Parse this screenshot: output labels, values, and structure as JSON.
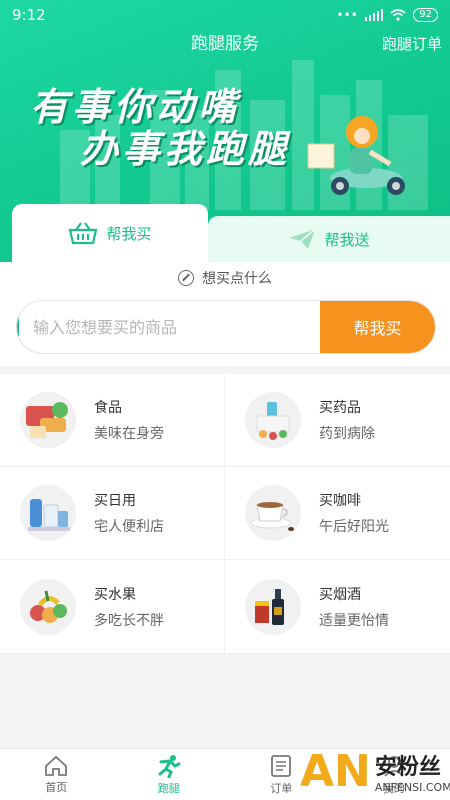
{
  "status": {
    "time": "9:12",
    "dots": "•••",
    "battery": "92"
  },
  "nav": {
    "title": "跑腿服务",
    "right": "跑腿订单"
  },
  "banner": {
    "line1": "有事你动嘴",
    "line2": "办事我跑腿"
  },
  "tabs": [
    {
      "label": "帮我买",
      "icon": "basket-icon",
      "active": true
    },
    {
      "label": "帮我送",
      "icon": "paper-plane-icon",
      "active": false
    }
  ],
  "hint": "想买点什么",
  "search": {
    "placeholder": "输入您想要买的商品",
    "button": "帮我买"
  },
  "categories": [
    {
      "title": "食品",
      "sub": "美味在身旁",
      "icon": "food-icon"
    },
    {
      "title": "买药品",
      "sub": "药到病除",
      "icon": "medicine-icon"
    },
    {
      "title": "买日用",
      "sub": "宅人便利店",
      "icon": "daily-goods-icon"
    },
    {
      "title": "买咖啡",
      "sub": "午后好阳光",
      "icon": "coffee-icon"
    },
    {
      "title": "买水果",
      "sub": "多吃长不胖",
      "icon": "fruit-icon"
    },
    {
      "title": "买烟酒",
      "sub": "适量更怡情",
      "icon": "tobacco-wine-icon"
    }
  ],
  "bottom_nav": [
    {
      "label": "首页",
      "icon": "home-icon",
      "active": false
    },
    {
      "label": "跑腿",
      "icon": "runner-icon",
      "active": true
    },
    {
      "label": "订单",
      "icon": "order-list-icon",
      "active": false
    },
    {
      "label": "我的",
      "icon": "user-icon",
      "active": false
    }
  ],
  "watermark": {
    "logo": "AN",
    "cn": "安粉丝",
    "en": "ANFENSI.COM"
  },
  "colors": {
    "brand_green": "#1bbf8a",
    "accent_orange": "#f7921e"
  }
}
